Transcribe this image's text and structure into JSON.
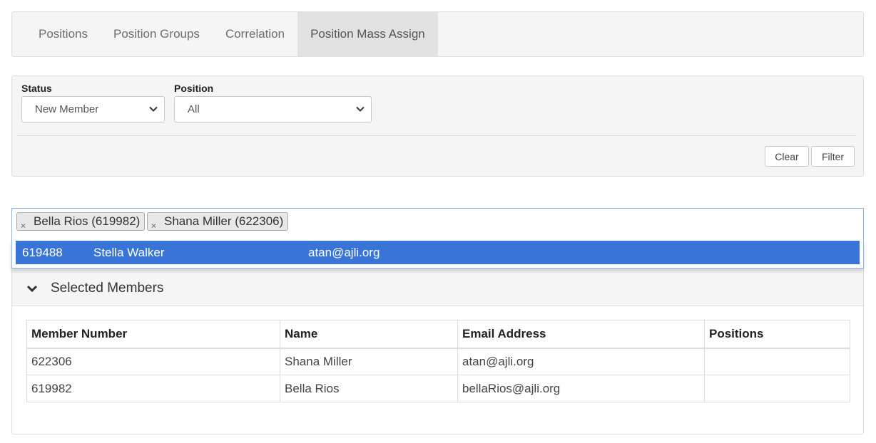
{
  "tabs": [
    {
      "label": "Positions",
      "active": false
    },
    {
      "label": "Position Groups",
      "active": false
    },
    {
      "label": "Correlation",
      "active": false
    },
    {
      "label": "Position Mass Assign",
      "active": true
    }
  ],
  "filter": {
    "status_label": "Status",
    "status_value": "New Member",
    "position_label": "Position",
    "position_value": "All",
    "clear_label": "Clear",
    "filter_label": "Filter"
  },
  "member_picker": {
    "tags": [
      {
        "label": "Bella Rios (619982)"
      },
      {
        "label": "Shana Miller (622306)"
      }
    ],
    "suggestion": {
      "number": "619488",
      "name": "Stella Walker",
      "email": "atan@ajli.org"
    }
  },
  "selected_members": {
    "title": "Selected Members",
    "columns": [
      "Member Number",
      "Name",
      "Email Address",
      "Positions"
    ],
    "rows": [
      {
        "number": "622306",
        "name": "Shana Miller",
        "email": "atan@ajli.org",
        "positions": ""
      },
      {
        "number": "619982",
        "name": "Bella Rios",
        "email": "bellaRios@ajli.org",
        "positions": ""
      }
    ]
  },
  "colors": {
    "highlight": "#3875d7",
    "panel_bg": "#f5f5f5",
    "active_tab_bg": "#e2e2e2"
  },
  "icons": {
    "select_arrow": "chevron-down-icon",
    "tag_remove": "close-icon",
    "collapse": "chevron-down-icon"
  }
}
